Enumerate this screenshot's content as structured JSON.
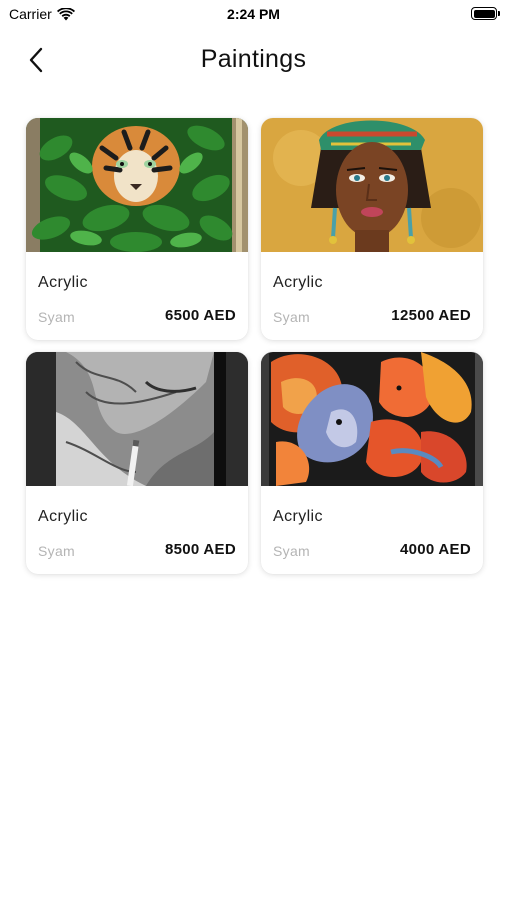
{
  "status_bar": {
    "carrier": "Carrier",
    "time": "2:24 PM"
  },
  "header": {
    "title": "Paintings",
    "back_icon": "chevron-left-icon"
  },
  "paintings": [
    {
      "image": "tiger-in-leaves painting",
      "type": "Acrylic",
      "artist": "Syam",
      "price": "6500 AED"
    },
    {
      "image": "woman-portrait painting",
      "type": "Acrylic",
      "artist": "Syam",
      "price": "12500 AED"
    },
    {
      "image": "old-man-smoking painting",
      "type": "Acrylic",
      "artist": "Syam",
      "price": "8500 AED"
    },
    {
      "image": "betta-fish painting",
      "type": "Acrylic",
      "artist": "Syam",
      "price": "4000 AED"
    }
  ],
  "colors": {
    "background": "#ffffff",
    "artist_text": "#b4b4b4",
    "price_text": "#111111"
  }
}
